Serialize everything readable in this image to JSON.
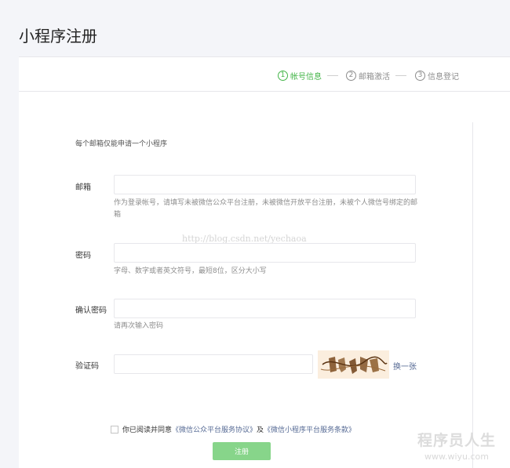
{
  "page": {
    "title": "小程序注册"
  },
  "steps": [
    {
      "num": "1",
      "label": "帐号信息",
      "active": true
    },
    {
      "num": "2",
      "label": "邮箱激活",
      "active": false
    },
    {
      "num": "3",
      "label": "信息登记",
      "active": false
    }
  ],
  "form": {
    "notice": "每个邮箱仅能申请一个小程序",
    "email": {
      "label": "邮箱",
      "value": "",
      "hint": "作为登录帐号，请填写未被微信公众平台注册，未被微信开放平台注册，未被个人微信号绑定的邮箱"
    },
    "password": {
      "label": "密码",
      "value": "",
      "hint": "字母、数字或者英文符号，最短8位，区分大小写"
    },
    "confirm": {
      "label": "确认密码",
      "value": "",
      "hint": "请再次输入密码"
    },
    "captcha": {
      "label": "验证码",
      "value": "",
      "swap_label": "换一张"
    }
  },
  "agreement": {
    "prefix": "你已阅读并同意",
    "link1": "《微信公众平台服务协议》",
    "middle": "及",
    "link2": "《微信小程序平台服务条款》"
  },
  "submit_label": "注册",
  "watermark": "http://blog.csdn.net/yechaoa",
  "corner_logo": {
    "title": "程序员人生",
    "url": "www.wiyu.com"
  },
  "colors": {
    "accent": "#44b549",
    "link": "#576b95",
    "button": "#87d58a"
  }
}
